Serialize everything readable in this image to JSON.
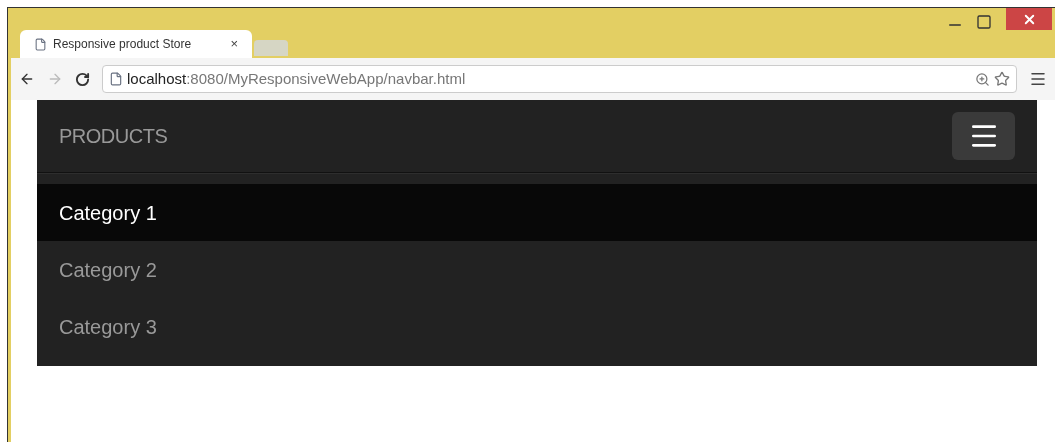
{
  "browser": {
    "tab": {
      "title": "Responsive product Store",
      "close": "×"
    },
    "address": {
      "host": "localhost",
      "path": ":8080/MyResponsiveWebApp/navbar.html"
    }
  },
  "navbar": {
    "brand": "PRODUCTS",
    "menu_expanded": true,
    "items": [
      {
        "label": "Category 1",
        "selected": true
      },
      {
        "label": "Category 2",
        "selected": false
      },
      {
        "label": "Category 3",
        "selected": false
      }
    ]
  }
}
